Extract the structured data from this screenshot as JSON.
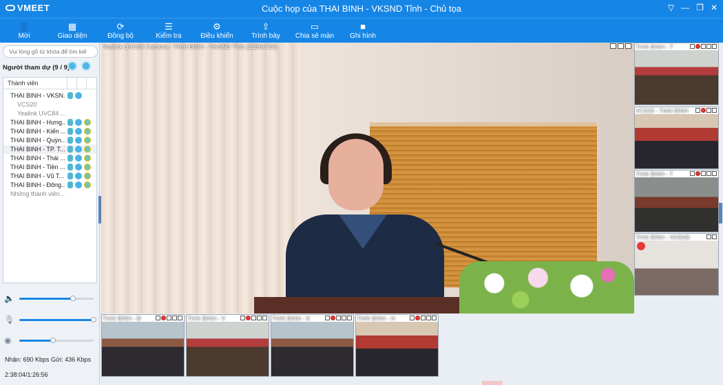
{
  "window": {
    "brand": "VMEET",
    "title": "Cuộc họp của THAI BINH - VKSND Tỉnh - Chủ tọa",
    "controls": [
      "▽",
      "—",
      "❐",
      "✕"
    ]
  },
  "toolbar": [
    {
      "label": "Mời",
      "icon": "invite-icon"
    },
    {
      "label": "Giao diện",
      "icon": "layout-icon"
    },
    {
      "label": "Đồng bộ",
      "icon": "sync-icon"
    },
    {
      "label": "Kiểm tra",
      "icon": "sliders-icon"
    },
    {
      "label": "Điều khiển",
      "icon": "gear-icon"
    },
    {
      "label": "Trình bày",
      "icon": "present-icon"
    },
    {
      "label": "Chia sẻ màn",
      "icon": "screen-share-icon"
    },
    {
      "label": "Ghi hình",
      "icon": "record-icon"
    }
  ],
  "sidebar": {
    "search_placeholder": "Vui lòng gõ từ khóa để tìm kiế",
    "participants_title": "Người tham dự (9 / 9)",
    "column_header": "Thành viên",
    "members": [
      {
        "name": "THAI BINH - VKSN...",
        "type": "main"
      },
      {
        "name": "VCS20",
        "type": "sub"
      },
      {
        "name": "Yealink UVC84 ...",
        "type": "sub"
      },
      {
        "name": "THAI BINH - Hưng...",
        "type": "member"
      },
      {
        "name": "THAI BINH - Kiến ...",
        "type": "member"
      },
      {
        "name": "THAI BINH - Quỳn...",
        "type": "member"
      },
      {
        "name": "THAI BINH - TP. T...",
        "type": "member"
      },
      {
        "name": "THAI BINH - Thái ...",
        "type": "member"
      },
      {
        "name": "THAI BINH - Tiền ...",
        "type": "member"
      },
      {
        "name": "THAI BINH - Vũ T...",
        "type": "member"
      },
      {
        "name": "THAI BINH - Đông...",
        "type": "member"
      },
      {
        "name": "Những thành viên...",
        "type": "dim"
      }
    ],
    "volume": {
      "speaker": 0.72,
      "mic": 1.0,
      "camera": 0.45
    },
    "stats": "Nhận: 690 Kbps Gửi: 436 Kbps",
    "clock": "2:38:04/1:26:56"
  },
  "main_video": {
    "label": "Yealink UVC84 Camera - THAI BINH - VKSND Tỉnh (1280x720)"
  },
  "right_thumbs": [
    {
      "label": "THAI BINH - T"
    },
    {
      "label": "VCS20 - THAI BINH"
    },
    {
      "label": "THAI BINH - T"
    },
    {
      "label": "THAI BINH - VKSND"
    }
  ],
  "bottom_thumbs": [
    {
      "label": "THAI BINH - Đ"
    },
    {
      "label": "THAI BINH - V"
    },
    {
      "label": "THAI BINH - K"
    },
    {
      "label": "THAI BINH - H"
    }
  ]
}
